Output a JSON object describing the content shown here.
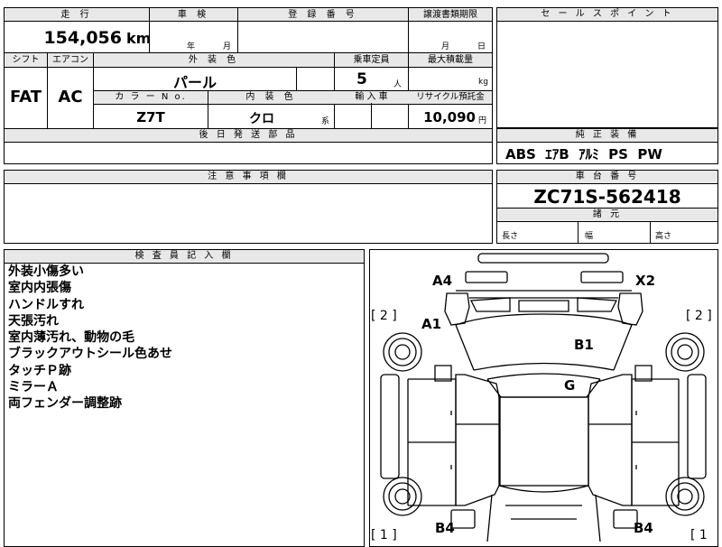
{
  "top_info": {
    "mileage_label": "走 行",
    "mileage_value": "154,056",
    "mileage_unit": "km",
    "inspection_label": "車 検",
    "inspection_year_unit": "年",
    "inspection_month_unit": "月",
    "registration_label": "登 録 番 号",
    "transfer_deadline_label": "譲渡書類期限",
    "transfer_month_unit": "月",
    "transfer_day_unit": "日"
  },
  "spec": {
    "shift_label": "シフト",
    "shift_value": "FAT",
    "ac_label": "エアコン",
    "ac_value": "AC",
    "exterior_color_label": "外 装 色",
    "exterior_color_value": "パール",
    "capacity_label": "乗車定員",
    "capacity_value": "5",
    "capacity_unit": "人",
    "max_load_label": "最大積載量",
    "max_load_unit": "kg",
    "color_no_label": "カ ラ ー N o.",
    "color_no_value": "Z7T",
    "interior_color_label": "内 装 色",
    "interior_color_value": "クロ",
    "interior_color_suffix": "系",
    "import_label": "輸 入 車",
    "recycle_label": "リサイクル預託金",
    "recycle_value": "10,090",
    "recycle_unit": "円"
  },
  "later_parts_label": "後 日 発 送 部 品",
  "sales_point_label": "セ ー ル ス ポ イ ン ト",
  "genuine_equipment": {
    "label": "純 正 装 備",
    "value": "ABS  ｴｱB  ｱﾙﾐ  PS  PW"
  },
  "caution_label": "注 意 事 項 欄",
  "chassis": {
    "label": "車 台 番 号",
    "value": "ZC71S-562418"
  },
  "dimensions": {
    "label": "諸 元",
    "length_label": "長さ",
    "width_label": "幅",
    "height_label": "高さ"
  },
  "inspector": {
    "label": "検 査 員 記 入 欄",
    "notes": [
      "外装小傷多い",
      "室内内張傷",
      "ハンドルすれ",
      "天張汚れ",
      "室内薄汚れ、動物の毛",
      "ブラックアウトシール色あせ",
      "タッチＰ跡",
      "ミラーＡ",
      "両フェンダー調整跡"
    ]
  },
  "diagram": {
    "marks": {
      "a4": "A4",
      "x2": "X2",
      "a1": "A1",
      "b1": "B1",
      "g": "G",
      "b4_left": "B4",
      "b4_right": "B4"
    },
    "tire_left_front": "[ 2 ]",
    "tire_right_front": "[ 2 ]",
    "tire_left_rear": "[ 1 ]",
    "tire_right_rear": "[ 1"
  }
}
